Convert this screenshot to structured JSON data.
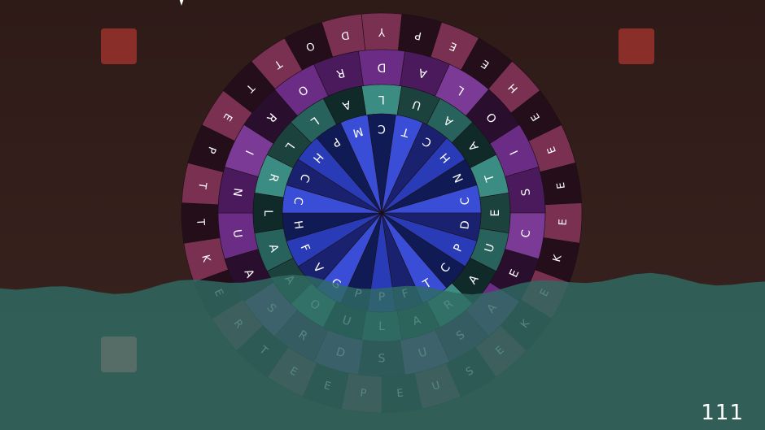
{
  "colors": {
    "background_top": "#2e1a17",
    "background_bottom": "#3a2420",
    "water": "#2f6b63",
    "water_edge": "#3d7f76",
    "corner_active": "#8a2e2a",
    "corner_inactive": "#5c6f6a",
    "outer_ring_colors": [
      "#7a3050",
      "#c05c80",
      "#5a1a35",
      "#240e1a",
      "#8a3a5c",
      "#b04c74"
    ],
    "ring2_colors": [
      "#4a1a5c",
      "#6b2c86",
      "#2a0e2e",
      "#7a3a95"
    ],
    "ring3_colors": [
      "#27635c",
      "#1c423e",
      "#3b8c82",
      "#0f2a28"
    ],
    "ring4_colors": [
      "#2a3bb8",
      "#1a2270",
      "#3a4dd6",
      "#101a55"
    ]
  },
  "wheel": {
    "outer_ring": [
      "Y",
      "P",
      "E",
      "E",
      "H",
      "E",
      "E",
      "E",
      "E",
      "K",
      "E",
      "K",
      "E",
      "S",
      "U",
      "E",
      "P",
      "E",
      "E",
      "T",
      "R",
      "E",
      "K",
      "T",
      "T",
      "P",
      "E",
      "T",
      "T",
      "O",
      "D"
    ],
    "ring2": [
      "D",
      "A",
      "L",
      "O",
      "I",
      "S",
      "C",
      "E",
      "A",
      "S",
      "U",
      "S",
      "D",
      "R",
      "S",
      "A",
      "U",
      "N",
      "I",
      "R",
      "O",
      "R"
    ],
    "ring3": [
      "L",
      "U",
      "A",
      "A",
      "T",
      "E",
      "U",
      "A",
      "R",
      "A",
      "L",
      "U",
      "O",
      "A",
      "A",
      "L",
      "R",
      "L",
      "L",
      "A"
    ],
    "ring4": [
      "C",
      "T",
      "C",
      "H",
      "N",
      "C",
      "D",
      "P",
      "C",
      "T",
      "F",
      "P",
      "P",
      "G",
      "V",
      "F",
      "H",
      "C",
      "C",
      "H",
      "P",
      "M"
    ]
  },
  "corner_squares": [
    {
      "name": "top-left",
      "state": "active"
    },
    {
      "name": "top-right",
      "state": "active"
    },
    {
      "name": "bottom-left",
      "state": "inactive"
    }
  ],
  "score": "111"
}
